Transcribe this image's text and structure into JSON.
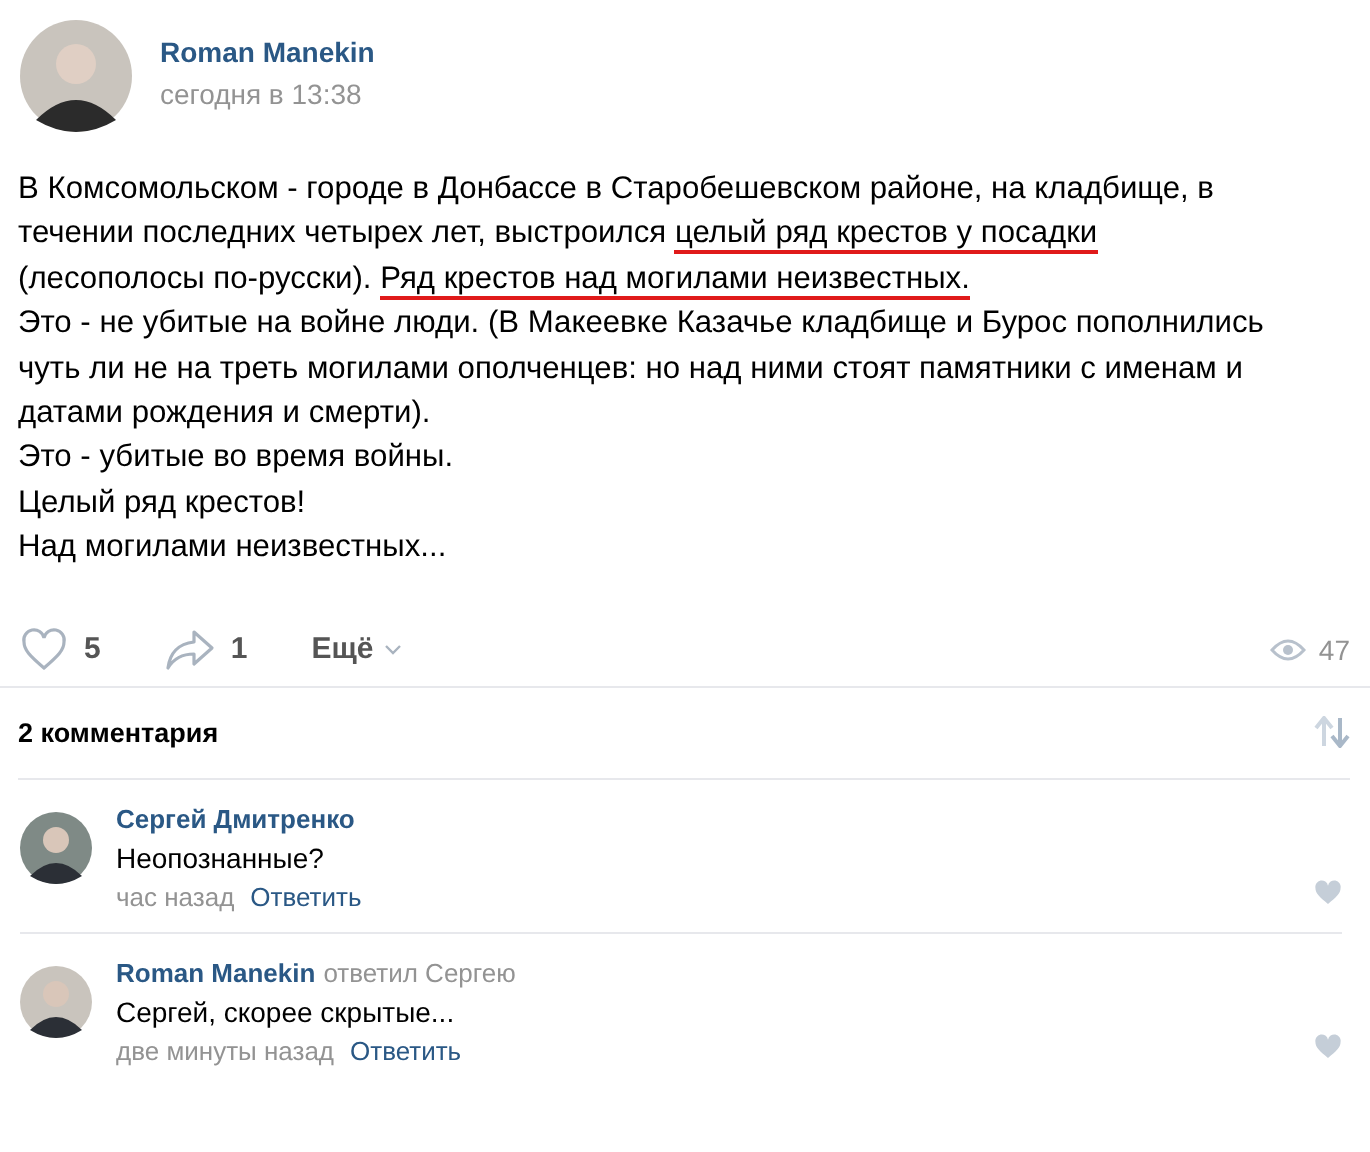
{
  "post": {
    "author": "Roman Manekin",
    "time": "сегодня в 13:38",
    "lines": [
      [
        {
          "text": "В Комсомольском - городе в Донбассе в Старобешевском районе, на кладбище, в",
          "marked": false
        }
      ],
      [
        {
          "text": "течении последних четырех лет, выстроился ",
          "marked": false
        },
        {
          "text": "целый ряд крестов у посадки",
          "marked": true
        }
      ],
      [
        {
          "text": "(лесополосы по-русски). ",
          "marked": false
        },
        {
          "text": "Ряд крестов над могилами неизвестных.",
          "marked": true
        }
      ],
      [
        {
          "text": "Это - не убитые на войне люди. (В Макеевке Казачье кладбище и Бурос пополнились",
          "marked": false
        }
      ],
      [
        {
          "text": "чуть ли не на треть могилами ополченцев: но над ними стоят памятники с именам и",
          "marked": false
        }
      ],
      [
        {
          "text": "датами рождения и смерти).",
          "marked": false
        }
      ],
      [
        {
          "text": "Это - убитые во время войны.",
          "marked": false
        }
      ],
      [
        {
          "text": "Целый ряд крестов!",
          "marked": false
        }
      ],
      [
        {
          "text": "Над могилами неизвестных...",
          "marked": false
        }
      ]
    ],
    "likes": "5",
    "shares": "1",
    "more": "Ещё",
    "views": "47"
  },
  "comments_header": "2 комментария",
  "comments": [
    {
      "author": "Сергей Дмитренко",
      "text": "Неопознанные?",
      "time": "час назад",
      "reply": "Ответить"
    },
    {
      "author": "Roman Manekin",
      "reply_to": "ответил Сергею",
      "text": "Сергей, скорее скрытые...",
      "time": "две минуты назад",
      "reply": "Ответить"
    }
  ]
}
